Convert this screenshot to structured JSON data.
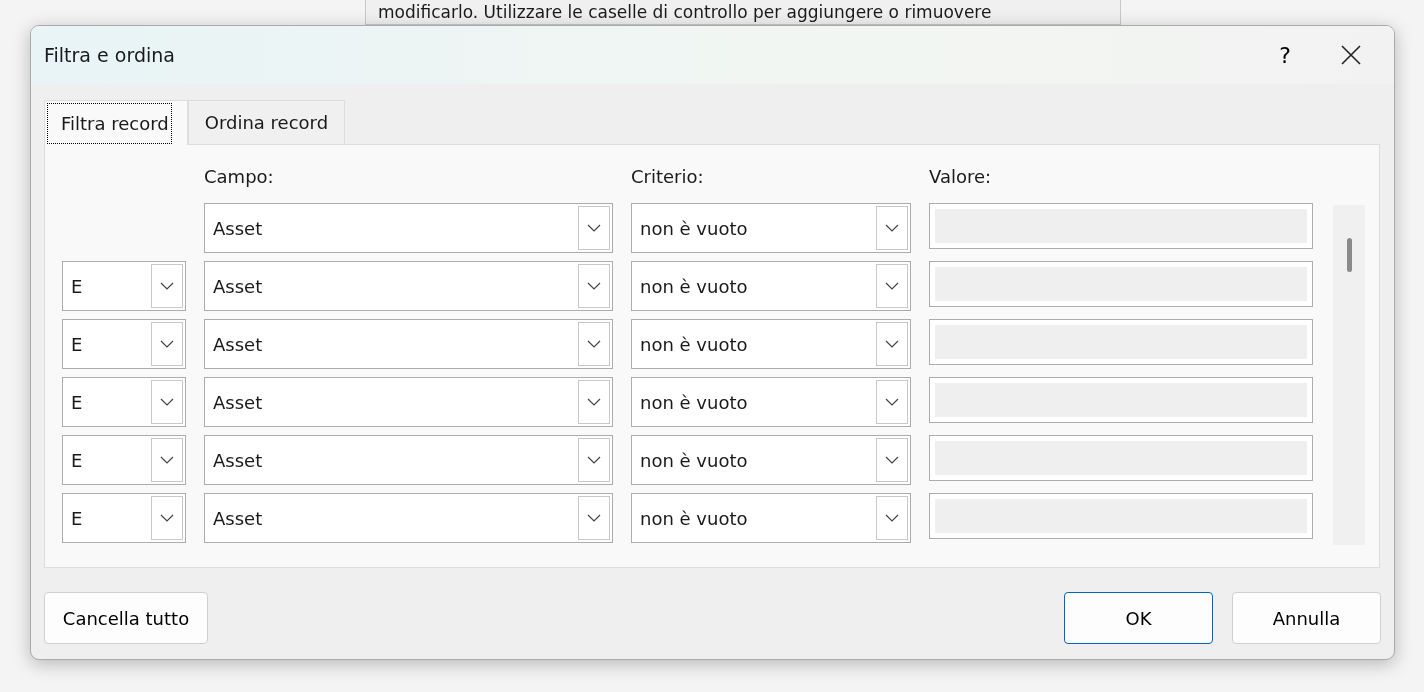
{
  "background_window": {
    "text": "modificarlo. Utilizzare le caselle di controllo per aggiungere o rimuovere"
  },
  "dialog": {
    "title": "Filtra e ordina",
    "help": "?"
  },
  "tabs": [
    {
      "label": "Filtra record",
      "selected": true
    },
    {
      "label": "Ordina record",
      "selected": false
    }
  ],
  "columns": {
    "field": "Campo:",
    "criterion": "Criterio:",
    "value": "Valore:"
  },
  "rows": [
    {
      "field": "Asset",
      "criterion": "non è vuoto",
      "value_disabled": true
    },
    {
      "logic": "E",
      "field": "Asset",
      "criterion": "non è vuoto",
      "value_disabled": true
    },
    {
      "logic": "E",
      "field": "Asset",
      "criterion": "non è vuoto",
      "value_disabled": true
    },
    {
      "logic": "E",
      "field": "Asset",
      "criterion": "non è vuoto",
      "value_disabled": true
    },
    {
      "logic": "E",
      "field": "Asset",
      "criterion": "non è vuoto",
      "value_disabled": true
    },
    {
      "logic": "E",
      "field": "Asset",
      "criterion": "non è vuoto",
      "value_disabled": true
    }
  ],
  "buttons": [
    {
      "label": "Cancella tutto",
      "default": false
    },
    {
      "label": "OK",
      "default": true
    },
    {
      "label": "Annulla",
      "default": false
    }
  ]
}
